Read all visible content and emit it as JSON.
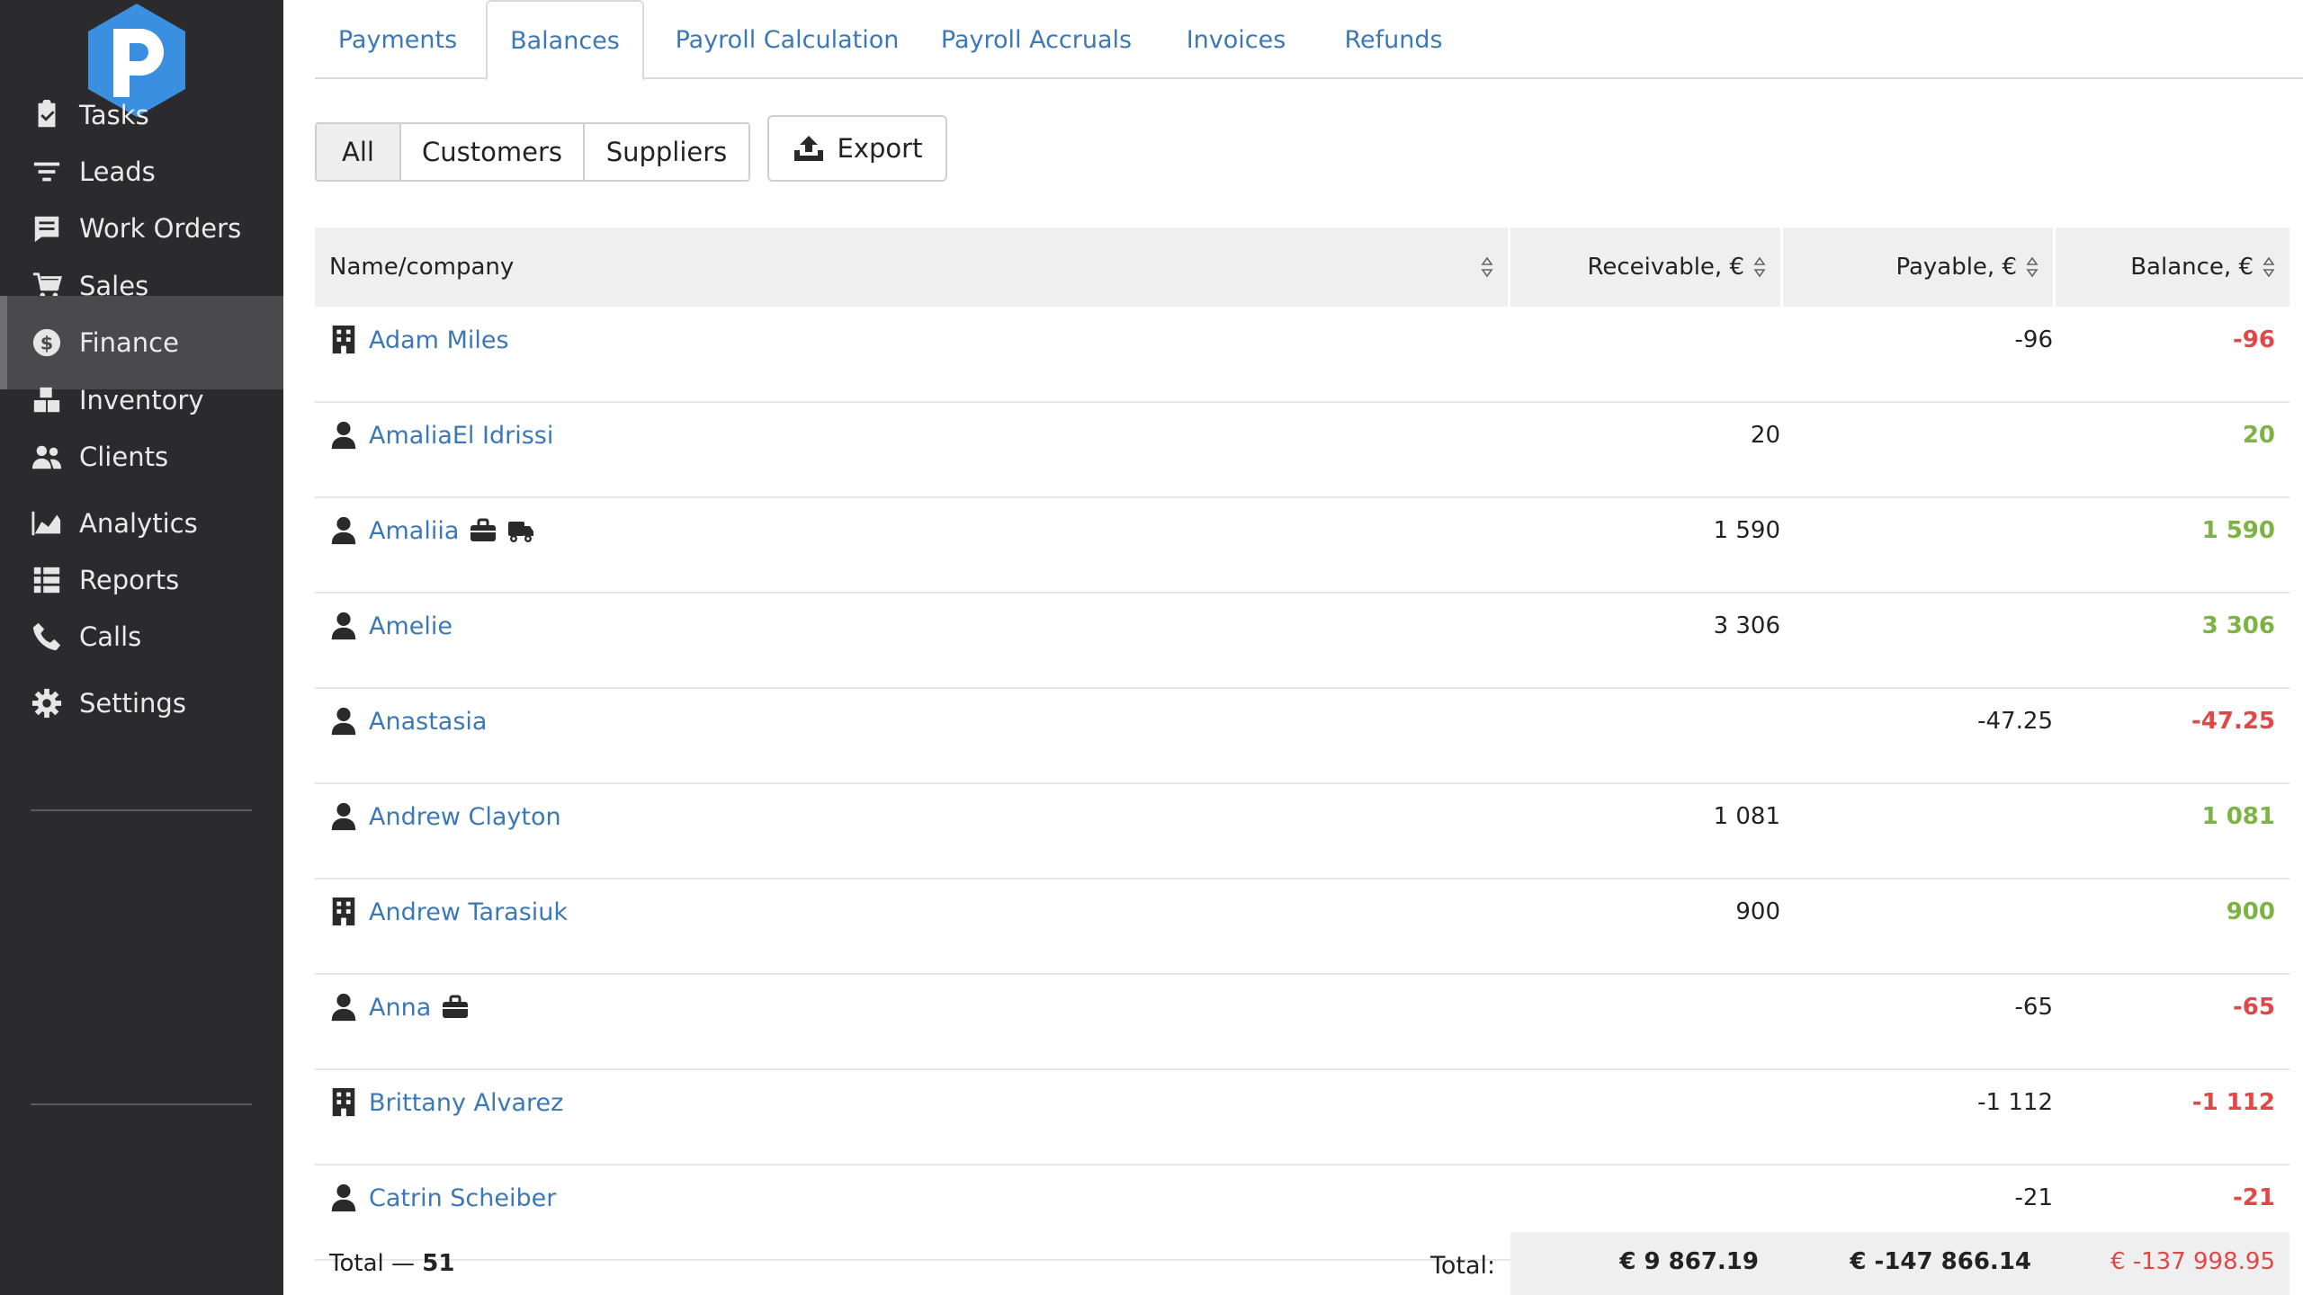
{
  "sidebar": {
    "items": [
      {
        "label": "Tasks",
        "icon": "clipboard-check-icon"
      },
      {
        "label": "Leads",
        "icon": "filter-icon"
      },
      {
        "label": "Work Orders",
        "icon": "work-order-icon"
      },
      {
        "label": "Sales",
        "icon": "cart-icon"
      },
      {
        "label": "Finance",
        "icon": "dollar-circle-icon",
        "active": true
      },
      {
        "label": "Inventory",
        "icon": "boxes-icon"
      },
      {
        "label": "Clients",
        "icon": "users-icon"
      },
      {
        "label": "Analytics",
        "icon": "chart-area-icon"
      },
      {
        "label": "Reports",
        "icon": "list-icon"
      },
      {
        "label": "Calls",
        "icon": "phone-icon"
      },
      {
        "label": "Settings",
        "icon": "gear-icon"
      }
    ]
  },
  "tabs": [
    "Payments",
    "Balances",
    "Payroll Calculation",
    "Payroll Accruals",
    "Invoices",
    "Refunds"
  ],
  "active_tab": "Balances",
  "filters": [
    "All",
    "Customers",
    "Suppliers"
  ],
  "active_filter": "All",
  "export_label": "Export",
  "table": {
    "headers": {
      "name": "Name/company",
      "receivable": "Receivable, €",
      "payable": "Payable, €",
      "balance": "Balance, €"
    },
    "rows": [
      {
        "type": "company",
        "name": "Adam Miles",
        "receivable": "",
        "payable": "-96",
        "balance": "-96",
        "sign": "neg",
        "badges": []
      },
      {
        "type": "person",
        "name": "AmaliaEl Idrissi",
        "receivable": "20",
        "payable": "",
        "balance": "20",
        "sign": "pos",
        "badges": []
      },
      {
        "type": "person",
        "name": "Amaliia",
        "receivable": "1 590",
        "payable": "",
        "balance": "1 590",
        "sign": "pos",
        "badges": [
          "briefcase-icon",
          "truck-icon"
        ]
      },
      {
        "type": "person",
        "name": "Amelie",
        "receivable": "3 306",
        "payable": "",
        "balance": "3 306",
        "sign": "pos",
        "badges": []
      },
      {
        "type": "person",
        "name": "Anastasia",
        "receivable": "",
        "payable": "-47.25",
        "balance": "-47.25",
        "sign": "neg",
        "badges": []
      },
      {
        "type": "person",
        "name": "Andrew Clayton",
        "receivable": "1 081",
        "payable": "",
        "balance": "1 081",
        "sign": "pos",
        "badges": []
      },
      {
        "type": "company",
        "name": "Andrew Tarasiuk",
        "receivable": "900",
        "payable": "",
        "balance": "900",
        "sign": "pos",
        "badges": []
      },
      {
        "type": "person",
        "name": "Anna",
        "receivable": "",
        "payable": "-65",
        "balance": "-65",
        "sign": "neg",
        "badges": [
          "briefcase-icon"
        ]
      },
      {
        "type": "company",
        "name": "Brittany Alvarez",
        "receivable": "",
        "payable": "-1 112",
        "balance": "-1 112",
        "sign": "neg",
        "badges": []
      },
      {
        "type": "person",
        "name": "Catrin Scheiber",
        "receivable": "",
        "payable": "-21",
        "balance": "-21",
        "sign": "neg",
        "badges": []
      }
    ]
  },
  "footer": {
    "total_prefix": "Total — ",
    "total_count": "51",
    "total_label": "Total:",
    "receivable_sum": "€ 9 867.19",
    "payable_sum": "€ -147 866.14",
    "balance_sum": "€ -137 998.95"
  },
  "colors": {
    "sidebar_bg": "#2b2b2d",
    "accent": "#3b78b8",
    "negative": "#e04848",
    "positive": "#7cb342",
    "logo_blue": "#3a8fe0"
  }
}
